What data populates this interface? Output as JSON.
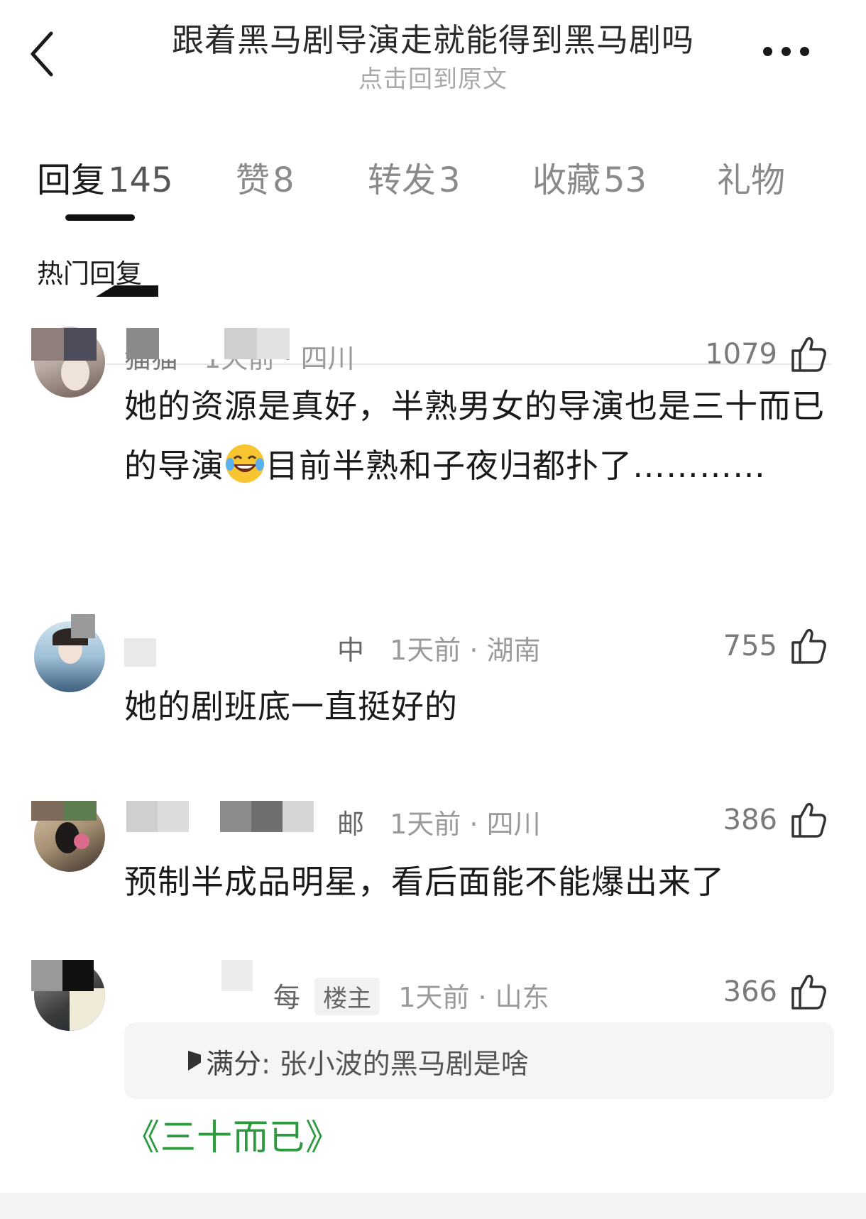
{
  "header": {
    "title": "跟着黑马剧导演走就能得到黑马剧吗",
    "subtitle": "点击回到原文"
  },
  "tabs": [
    {
      "label": "回复",
      "count": "145",
      "active": true
    },
    {
      "label": "赞",
      "count": "8"
    },
    {
      "label": "转发",
      "count": "3"
    },
    {
      "label": "收藏",
      "count": "53"
    },
    {
      "label": "礼物",
      "count": ""
    }
  ],
  "section_title": "热门回复",
  "comments": [
    {
      "name": "猫猫",
      "time": "1天前",
      "location": "四川",
      "likes": "1079",
      "text_before_emoji": "她的资源是真好，半熟男女的导演也是三十而已的导演",
      "emoji": "laughing-tears",
      "text_after_emoji": "目前半熟和子夜归都扑了…………"
    },
    {
      "name_tail": "中",
      "time": "1天前",
      "location": "湖南",
      "likes": "755",
      "text": "她的剧班底一直挺好的"
    },
    {
      "name_tail": "邮",
      "time": "1天前",
      "location": "四川",
      "likes": "386",
      "text": "预制半成品明星，看后面能不能爆出来了"
    },
    {
      "name_tail": "每",
      "badge": "楼主",
      "time": "1天前",
      "location": "山东",
      "likes": "366",
      "quote_name": "满分",
      "quote_text": "张小波的黑马剧是啥",
      "text": "《三十而已》"
    }
  ],
  "colors": {
    "accent_green": "#2d9a3f",
    "text_primary": "#1a1a1a",
    "text_secondary": "#9a9a9a",
    "quote_bg": "#f5f5f5"
  },
  "icons": {
    "back": "chevron-left-icon",
    "more": "more-dots-icon",
    "like": "thumbs-up-icon"
  }
}
